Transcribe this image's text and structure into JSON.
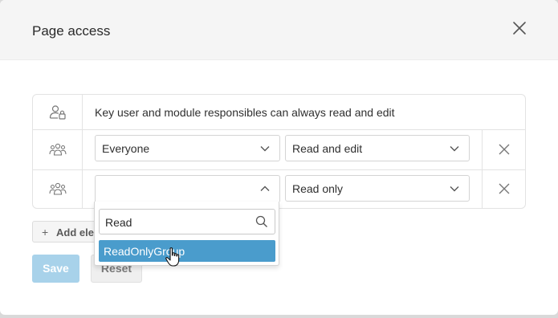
{
  "dialog": {
    "title": "Page access"
  },
  "access_rows": [
    {
      "icon": "user-lock-icon",
      "text": "Key user and module responsibles can always read and edit"
    },
    {
      "icon": "users-group-icon",
      "group": "Everyone",
      "permission": "Read and edit"
    },
    {
      "icon": "users-group-icon",
      "group": "",
      "permission": "Read only"
    }
  ],
  "dropdown": {
    "search_value": "Read",
    "options": [
      "ReadOnlyGroup"
    ]
  },
  "actions": {
    "add_label": "Add elem",
    "save_label": "Save",
    "reset_label": "Reset"
  },
  "colors": {
    "primary_disabled": "#a8d2ea",
    "option_highlight": "#4a9ccc"
  }
}
